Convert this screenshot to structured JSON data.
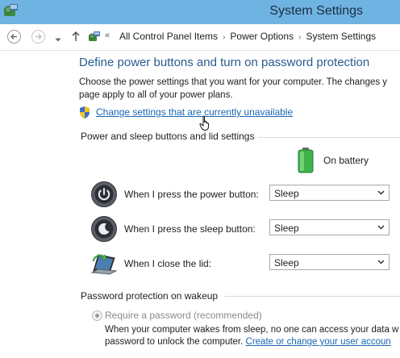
{
  "window": {
    "title": "System Settings",
    "app_icon": "control-panel-icon"
  },
  "navigation": {
    "back_icon": "back-arrow-icon",
    "forward_icon": "forward-arrow-icon",
    "recent_icon": "chevron-down-icon",
    "up_icon": "up-arrow-icon",
    "breadcrumb_overflow": "«",
    "breadcrumbs": [
      "All Control Panel Items",
      "Power Options",
      "System Settings"
    ]
  },
  "main": {
    "heading": "Define power buttons and turn on password protection",
    "description_line1": "Choose the power settings that you want for your computer. The changes y",
    "description_line2": "page apply to all of your power plans.",
    "change_settings_link": "Change settings that are currently unavailable",
    "power_section": {
      "label": "Power and sleep buttons and lid settings",
      "column_header": "On battery",
      "rows": [
        {
          "label": "When I press the power button:",
          "value": "Sleep",
          "icon": "power-button-icon"
        },
        {
          "label": "When I press the sleep button:",
          "value": "Sleep",
          "icon": "sleep-button-icon"
        },
        {
          "label": "When I close the lid:",
          "value": "Sleep",
          "icon": "laptop-lid-icon"
        }
      ]
    },
    "password_section": {
      "label": "Password protection on wakeup",
      "option_label": "Require a password (recommended)",
      "option_desc_line1": "When your computer wakes from sleep, no one can access your data w",
      "option_desc_line2_prefix": "password to unlock the computer. ",
      "option_desc_link": "Create or change your user accoun"
    }
  },
  "colors": {
    "titlebar": "#6fb3e3",
    "heading": "#2a5b8d",
    "link": "#1a66b3",
    "battery": "#3bb34a"
  }
}
